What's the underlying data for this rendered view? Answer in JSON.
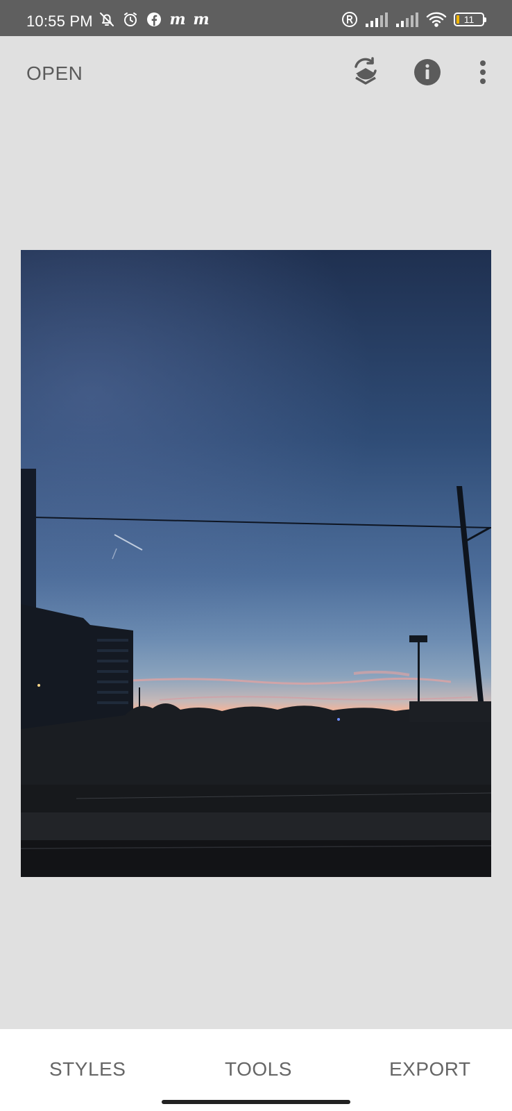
{
  "status_bar": {
    "time": "10:55 PM",
    "left_icons": [
      "bell-off-icon",
      "alarm-icon",
      "facebook-icon",
      "m-app-icon",
      "m-app-icon"
    ],
    "right_icons": [
      "registered-icon",
      "signal-icon",
      "signal-icon",
      "wifi-icon",
      "battery-icon"
    ],
    "battery_level": "11",
    "battery_percent": 11,
    "background_color": "#5f5f5f"
  },
  "app_bar": {
    "open_label": "OPEN",
    "icons": [
      "undo-layers-icon",
      "info-icon",
      "more-vertical-icon"
    ]
  },
  "photo": {
    "description_icon": "photo-image",
    "sky_top_color": "#1f3050",
    "sky_horizon_color": "#f3b49a"
  },
  "bottom_nav": {
    "styles_label": "STYLES",
    "tools_label": "TOOLS",
    "export_label": "EXPORT"
  },
  "colors": {
    "background": "#e0e0e0",
    "text_secondary": "#666666",
    "bottom_bar": "#ffffff"
  }
}
